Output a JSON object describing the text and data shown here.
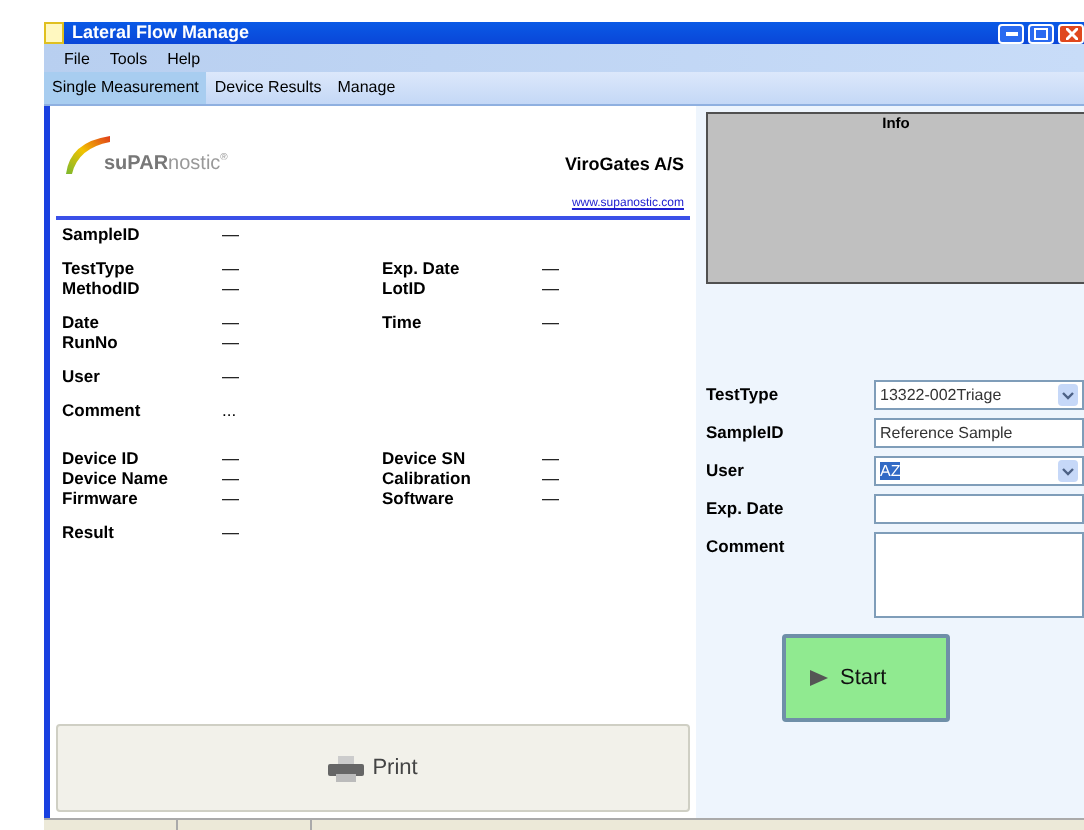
{
  "window": {
    "title": "Lateral Flow Manage"
  },
  "menu": [
    "File",
    "Tools",
    "Help"
  ],
  "tabs": [
    {
      "label": "Single Measurement",
      "selected": true
    },
    {
      "label": "Device Results",
      "selected": false
    },
    {
      "label": "Manage",
      "selected": false
    }
  ],
  "header": {
    "brand": "**suPAR**nostic$^{®}$",
    "company": "ViroGates A/S",
    "link": "www.supanostic.com"
  },
  "details": [
    [
      {
        "label": "SampleID",
        "value": "—"
      }
    ],
    [
      {
        "label": "TestType",
        "value": "—",
        "label2": "Exp. Date",
        "value2": "—"
      },
      {
        "label": "MethodID",
        "value": "—",
        "label2": "LotID",
        "value2": "—"
      }
    ],
    [
      {
        "label": "Date",
        "value": "—",
        "label2": "Time",
        "value2": "—"
      },
      {
        "label": "RunNo",
        "value": "—"
      }
    ],
    [
      {
        "label": "User",
        "value": "—"
      }
    ],
    [
      {
        "label": "Comment",
        "value": "..."
      }
    ],
    [
      {
        "label": "Device ID",
        "value": "—",
        "label2": "Device SN",
        "value2": "—"
      },
      {
        "label": "Device Name",
        "value": "—",
        "label2": "Calibration",
        "value2": "—"
      },
      {
        "label": "Firmware",
        "value": "—",
        "label2": "Software",
        "value2": "—"
      }
    ],
    [
      {
        "label": "Result",
        "value": "—"
      }
    ]
  ],
  "info": {
    "title": "Info"
  },
  "form": [
    {
      "kind": "select",
      "label": "TestType",
      "value": "13322-002Triage",
      "highlighted": false
    },
    {
      "kind": "text",
      "label": "SampleID",
      "value": "Reference Sample"
    },
    {
      "kind": "select",
      "label": "User",
      "value": "AZ",
      "highlighted": true
    },
    {
      "kind": "text",
      "label": "Exp. Date"
    },
    {
      "kind": "textarea",
      "label": "Comment"
    }
  ],
  "start_button": "Start",
  "print_button": "Print"
}
